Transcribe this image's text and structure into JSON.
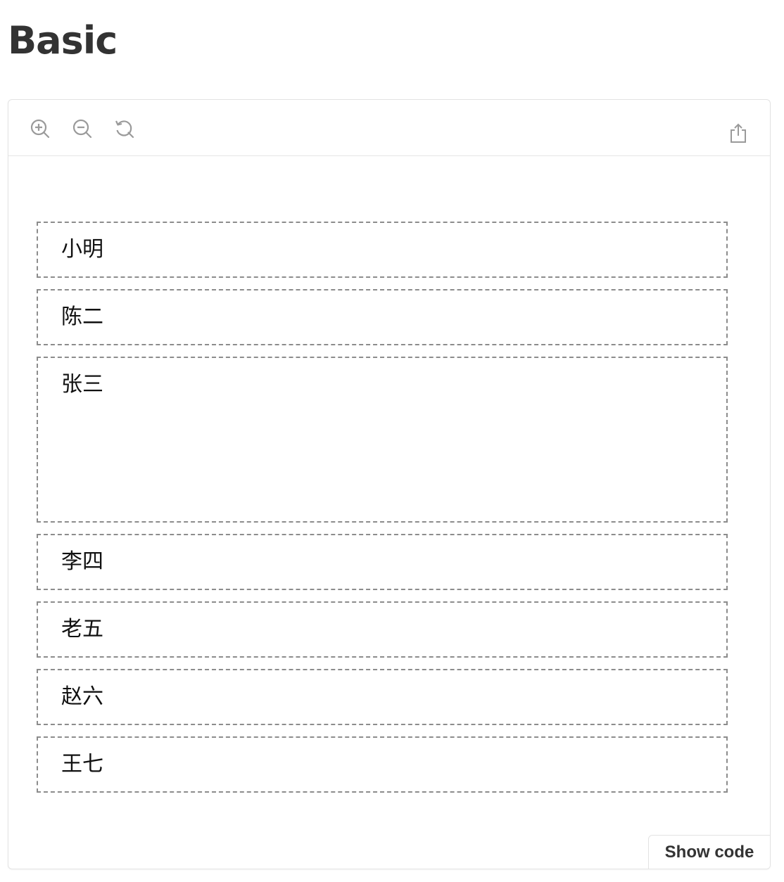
{
  "page": {
    "title": "Basic"
  },
  "toolbar": {
    "zoom_in_icon": "zoom-in-icon",
    "zoom_out_icon": "zoom-out-icon",
    "reset_icon": "reset-icon",
    "export_icon": "export-icon"
  },
  "items": [
    {
      "label": "小明"
    },
    {
      "label": "陈二"
    },
    {
      "label": "张三"
    },
    {
      "label": "李四"
    },
    {
      "label": "老五"
    },
    {
      "label": "赵六"
    },
    {
      "label": "王七"
    }
  ],
  "footer": {
    "show_code_label": "Show code"
  },
  "colors": {
    "dashed_border": "#8c8c8c",
    "icon": "#9a9a9a",
    "title": "#333333"
  }
}
